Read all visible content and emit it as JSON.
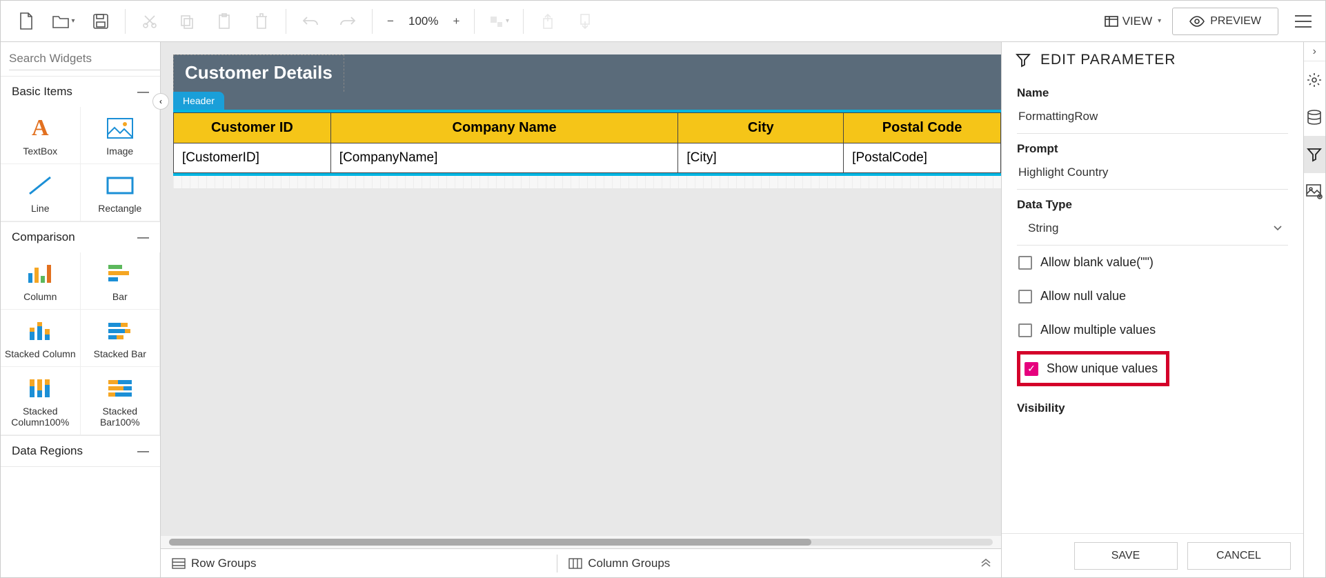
{
  "toolbar": {
    "zoom": "100%",
    "view_label": "VIEW",
    "preview_label": "PREVIEW"
  },
  "sidebar": {
    "search_placeholder": "Search Widgets",
    "categories": [
      {
        "name": "Basic Items",
        "items": [
          {
            "label": "TextBox"
          },
          {
            "label": "Image"
          },
          {
            "label": "Line"
          },
          {
            "label": "Rectangle"
          }
        ]
      },
      {
        "name": "Comparison",
        "items": [
          {
            "label": "Column"
          },
          {
            "label": "Bar"
          },
          {
            "label": "Stacked Column"
          },
          {
            "label": "Stacked Bar"
          },
          {
            "label": "Stacked Column100%"
          },
          {
            "label": "Stacked Bar100%"
          }
        ]
      },
      {
        "name": "Data Regions",
        "items": []
      }
    ]
  },
  "report": {
    "title": "Customer Details",
    "header_tag": "Header",
    "columns": [
      "Customer ID",
      "Company Name",
      "City",
      "Postal Code"
    ],
    "row_fields": [
      "[CustomerID]",
      "[CompanyName]",
      "[City]",
      "[PostalCode]"
    ]
  },
  "groups_bar": {
    "row_groups": "Row Groups",
    "column_groups": "Column Groups"
  },
  "param_panel": {
    "title": "EDIT PARAMETER",
    "name_label": "Name",
    "name_value": "FormattingRow",
    "prompt_label": "Prompt",
    "prompt_value": "Highlight Country",
    "datatype_label": "Data Type",
    "datatype_value": "String",
    "allow_blank": "Allow blank value(\"\")",
    "allow_null": "Allow null value",
    "allow_multiple": "Allow multiple values",
    "show_unique": "Show unique values",
    "visibility_label": "Visibility",
    "save": "SAVE",
    "cancel": "CANCEL"
  }
}
